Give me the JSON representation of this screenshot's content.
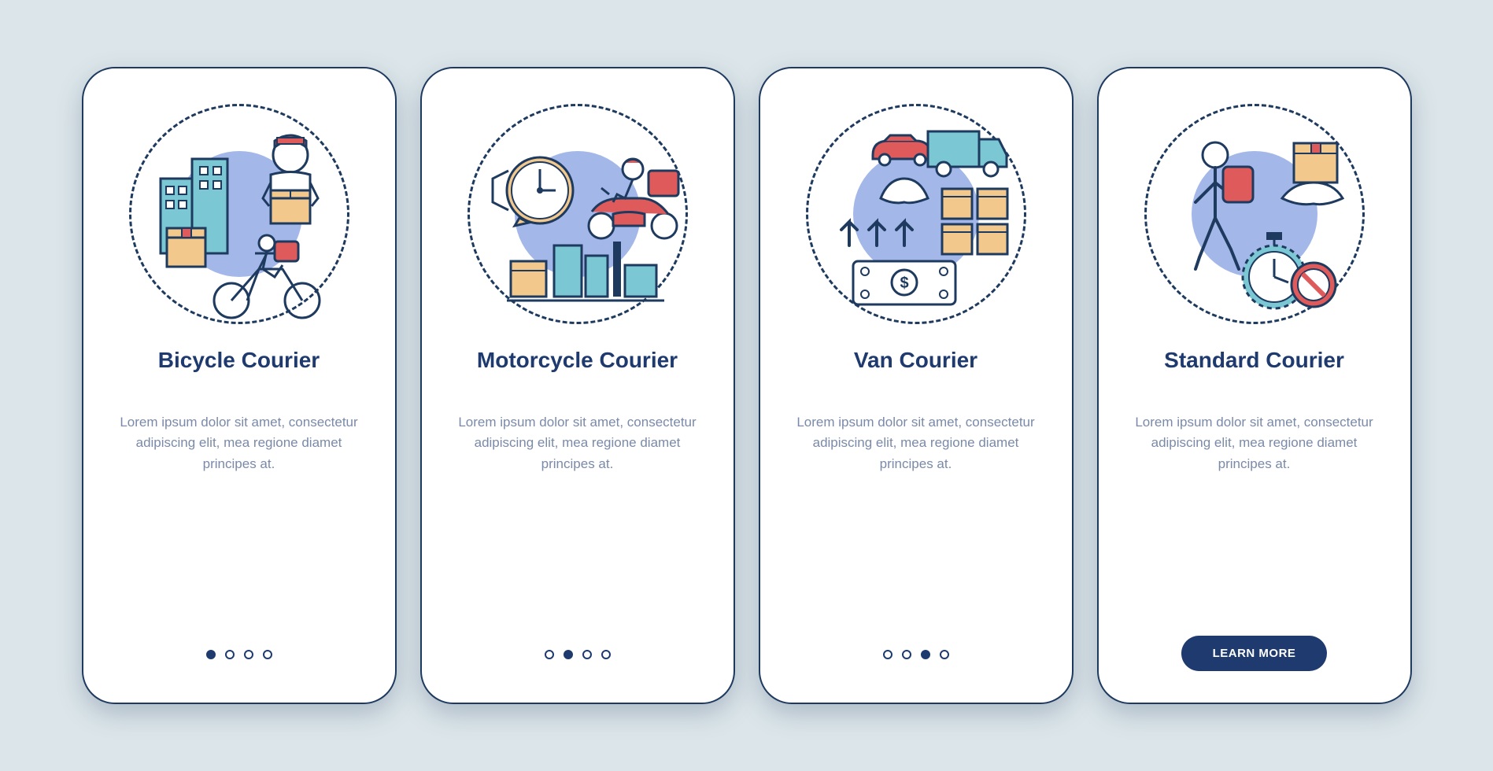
{
  "colors": {
    "bg": "#dce6ea",
    "navy": "#1e3a6e",
    "red": "#df5a5a",
    "tan": "#f2c88c",
    "teal": "#7bc8d4",
    "blob": "#a3b8e8"
  },
  "screens": [
    {
      "title": "Bicycle Courier",
      "desc": "Lorem ipsum dolor sit amet, consectetur adipiscing elit, mea regione diamet principes at.",
      "active_dot": 0,
      "icon": "bicycle-courier-icon"
    },
    {
      "title": "Motorcycle Courier",
      "desc": "Lorem ipsum dolor sit amet, consectetur adipiscing elit, mea regione diamet principes at.",
      "active_dot": 1,
      "icon": "motorcycle-courier-icon"
    },
    {
      "title": "Van Courier",
      "desc": "Lorem ipsum dolor sit amet, consectetur adipiscing elit, mea regione diamet principes at.",
      "active_dot": 2,
      "icon": "van-courier-icon"
    },
    {
      "title": "Standard Courier",
      "desc": "Lorem ipsum dolor sit amet, consectetur adipiscing elit, mea regione diamet principes at.",
      "active_dot": 3,
      "icon": "standard-courier-icon",
      "cta": "LEARN MORE"
    }
  ]
}
